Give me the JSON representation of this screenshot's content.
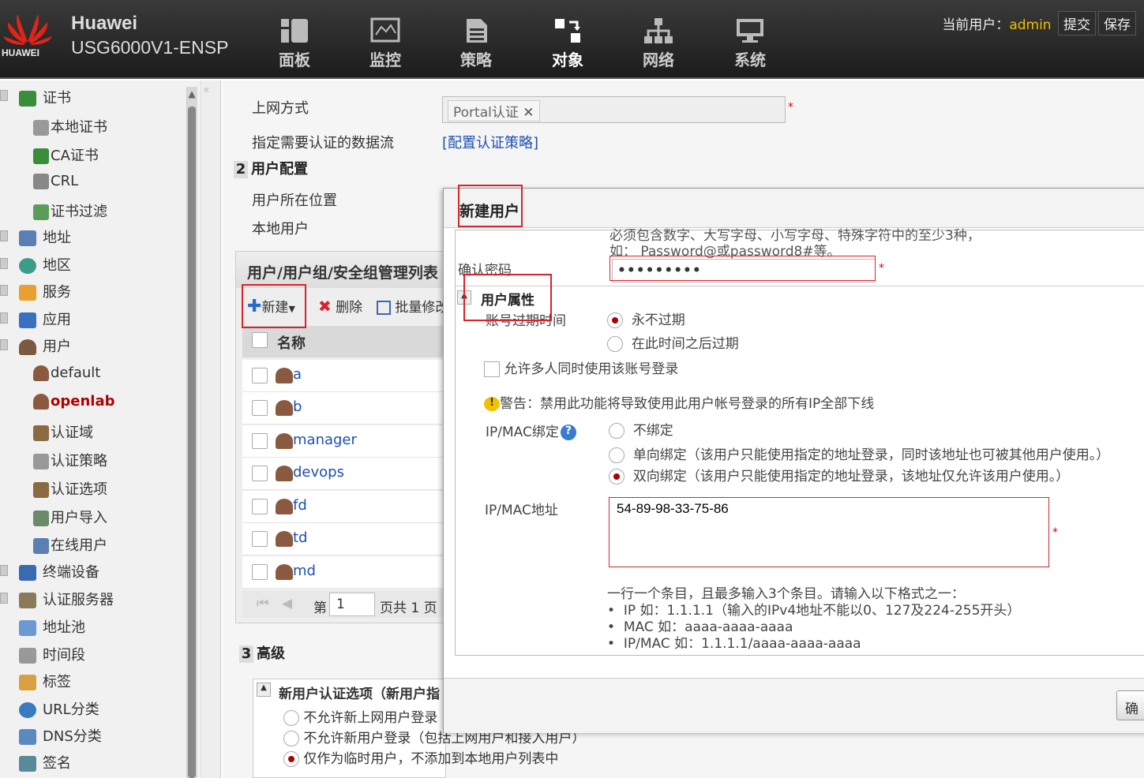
{
  "header": {
    "logo_text": "HUAWEI",
    "brand": "Huawei",
    "model": "USG6000V1-ENSP",
    "nav": [
      {
        "label": "面板",
        "icon": "dashboard-icon"
      },
      {
        "label": "监控",
        "icon": "monitor-icon"
      },
      {
        "label": "策略",
        "icon": "policy-icon"
      },
      {
        "label": "对象",
        "icon": "object-icon"
      },
      {
        "label": "网络",
        "icon": "network-icon"
      },
      {
        "label": "系统",
        "icon": "system-icon"
      }
    ],
    "active_nav": "对象",
    "current_user_label": "当前用户：",
    "current_user": "admin",
    "submit": "提交",
    "save": "保存"
  },
  "sidebar": {
    "items": [
      {
        "label": "证书"
      },
      {
        "label": "本地证书"
      },
      {
        "label": "CA证书"
      },
      {
        "label": "CRL"
      },
      {
        "label": "证书过滤"
      },
      {
        "label": "地址"
      },
      {
        "label": "地区"
      },
      {
        "label": "服务"
      },
      {
        "label": "应用"
      },
      {
        "label": "用户"
      },
      {
        "label": "default"
      },
      {
        "label": "openlab"
      },
      {
        "label": "认证域"
      },
      {
        "label": "认证策略"
      },
      {
        "label": "认证选项"
      },
      {
        "label": "用户导入"
      },
      {
        "label": "在线用户"
      },
      {
        "label": "终端设备"
      },
      {
        "label": "认证服务器"
      },
      {
        "label": "地址池"
      },
      {
        "label": "时间段"
      },
      {
        "label": "标签"
      },
      {
        "label": "URL分类"
      },
      {
        "label": "DNS分类"
      },
      {
        "label": "签名"
      }
    ]
  },
  "main": {
    "access_mode_label": "上网方式",
    "access_mode_value": "Portal认证",
    "dataflow_label": "指定需要认证的数据流",
    "dataflow_link": "[配置认证策略]",
    "sec2_num": "2",
    "sec2_title": "用户配置",
    "user_location_label": "用户所在位置",
    "local_user_label": "本地用户",
    "mgr_title": "用户/用户组/安全组管理列表",
    "toolbar": {
      "new": "新建",
      "delete": "删除",
      "batch": "批量修改"
    },
    "grid_header": "名称",
    "users": [
      "a",
      "b",
      "manager",
      "devops",
      "fd",
      "td",
      "md"
    ],
    "pager": {
      "page_prefix": "第",
      "page": "1",
      "page_suffix": "页共 1 页"
    },
    "sec3_num": "3",
    "sec3_title": "高级",
    "adv_title": "新用户认证选项（新用户指",
    "adv_options": [
      "不允许新上网用户登录",
      "不允许新用户登录（包括上网用户和接入用户）",
      "仅作为临时用户，不添加到本地用户列表中"
    ]
  },
  "dialog": {
    "title": "新建用户",
    "pwd_hint1": "必须包含数字、大写字母、小写字母、特殊字符中的至少3种，",
    "pwd_hint2": "如： Password@或password8#等。",
    "confirm_pwd_label": "确认密码",
    "confirm_pwd_value": "•••••••••",
    "attr_title": "用户属性",
    "expire_label": "账号过期时间",
    "expire_never": "永不过期",
    "expire_after": "在此时间之后过期",
    "multi_login": "允许多人同时使用该账号登录",
    "warning": "警告：禁用此功能将导致使用此用户帐号登录的所有IP全部下线",
    "bind_label": "IP/MAC绑定",
    "bind_none": "不绑定",
    "bind_one": "单向绑定（该用户只能使用指定的地址登录，同时该地址也可被其他用户使用。）",
    "bind_two": "双向绑定（该用户只能使用指定的地址登录，该地址仅允许该用户使用。）",
    "addr_label": "IP/MAC地址",
    "addr_value": "54-89-98-33-75-86",
    "help_intro": "一行一个条目，且最多输入3个条目。请输入以下格式之一：",
    "help_items": [
      "IP 如：1.1.1.1（输入的IPv4地址不能以0、127及224-255开头）",
      "MAC 如：aaaa-aaaa-aaaa",
      "IP/MAC 如：1.1.1.1/aaaa-aaaa-aaaa"
    ],
    "ok_button": "确"
  },
  "colors": {
    "accent_red": "#d9232b",
    "link": "#1a4fb0",
    "user_highlight": "#b00000",
    "admin": "#f0c000"
  }
}
